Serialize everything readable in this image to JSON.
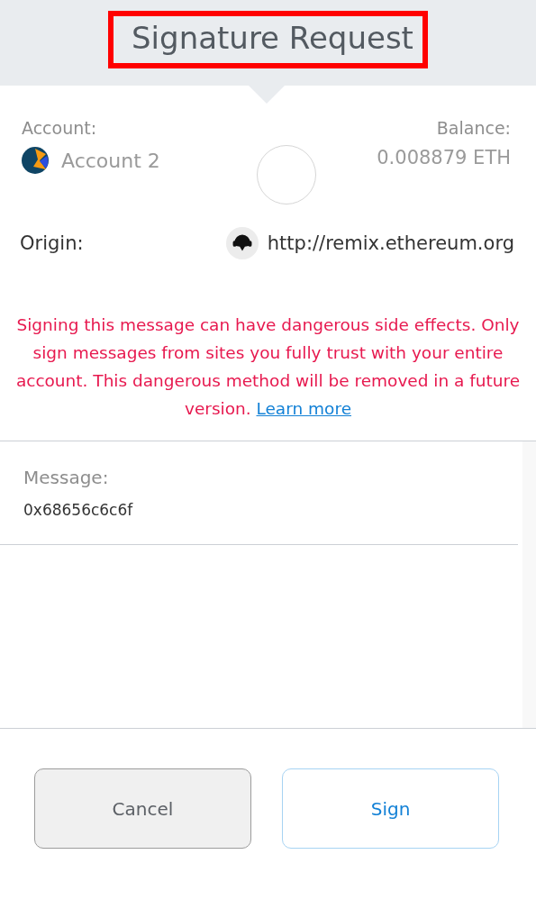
{
  "header": {
    "title": "Signature Request",
    "highlighted": true
  },
  "account": {
    "label": "Account:",
    "name": "Account 2"
  },
  "balance": {
    "label": "Balance:",
    "value": "0.008879 ETH"
  },
  "origin": {
    "label": "Origin:",
    "url": "http://remix.ethereum.org"
  },
  "warning": {
    "text": "Signing this message can have dangerous side effects. Only sign messages from sites you fully trust with your entire account. This dangerous method will be removed in a future version.",
    "link": "Learn more"
  },
  "message": {
    "label": "Message:",
    "value": "0x68656c6c6f"
  },
  "buttons": [
    {
      "label": "Cancel",
      "kind": "secondary"
    },
    {
      "label": "Sign",
      "kind": "primary"
    }
  ]
}
